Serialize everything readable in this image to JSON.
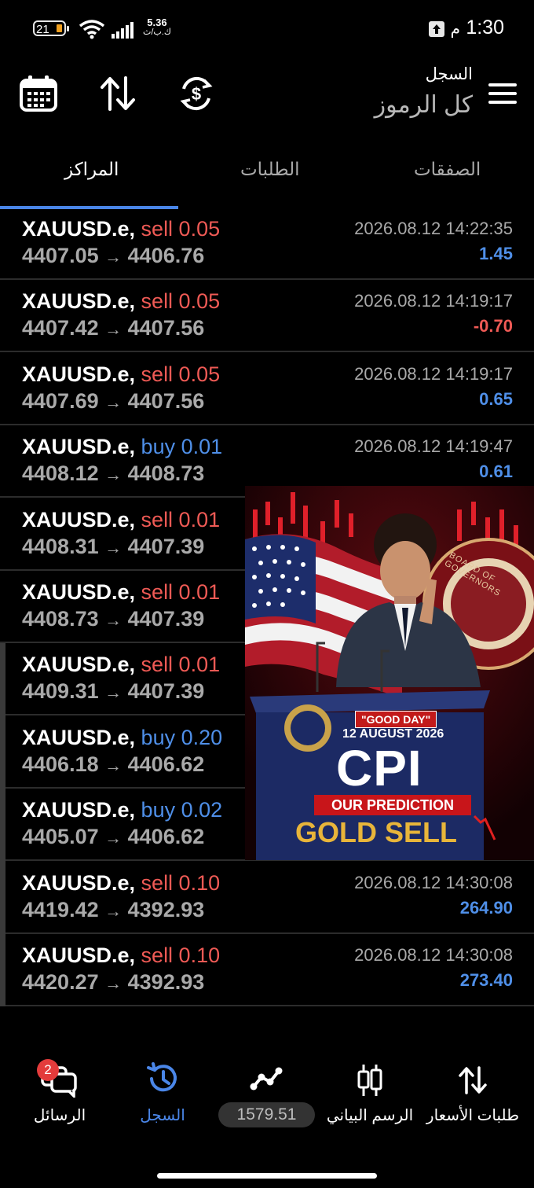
{
  "status": {
    "battery": "21",
    "speed_value": "5.36",
    "speed_unit": "ك.ب/ث",
    "time": "1:30",
    "ampm": "م"
  },
  "header": {
    "subtitle": "السجل",
    "title": "كل الرموز"
  },
  "tabs": [
    {
      "label": "الصفقات"
    },
    {
      "label": "الطلبات"
    },
    {
      "label": "المراكز"
    }
  ],
  "rows": [
    {
      "symbol": "XAUUSD.e,",
      "side": "sell 0.05",
      "type": "sell",
      "open": "4407.05",
      "close": "4406.76",
      "datetime": "2026.08.12 14:22:35",
      "profit": "1.45"
    },
    {
      "symbol": "XAUUSD.e,",
      "side": "sell 0.05",
      "type": "sell",
      "open": "4407.42",
      "close": "4407.56",
      "datetime": "2026.08.12 14:19:17",
      "profit": "-0.70"
    },
    {
      "symbol": "XAUUSD.e,",
      "side": "sell 0.05",
      "type": "sell",
      "open": "4407.69",
      "close": "4407.56",
      "datetime": "2026.08.12 14:19:17",
      "profit": "0.65"
    },
    {
      "symbol": "XAUUSD.e,",
      "side": "buy 0.01",
      "type": "buy",
      "open": "4408.12",
      "close": "4408.73",
      "datetime": "2026.08.12 14:19:47",
      "profit": "0.61"
    },
    {
      "symbol": "XAUUSD.e,",
      "side": "sell 0.01",
      "type": "sell",
      "open": "4408.31",
      "close": "4407.39",
      "datetime": "",
      "profit": ""
    },
    {
      "symbol": "XAUUSD.e,",
      "side": "sell 0.01",
      "type": "sell",
      "open": "4408.73",
      "close": "4407.39",
      "datetime": "",
      "profit": ""
    },
    {
      "symbol": "XAUUSD.e,",
      "side": "sell 0.01",
      "type": "sell",
      "open": "4409.31",
      "close": "4407.39",
      "datetime": "",
      "profit": ""
    },
    {
      "symbol": "XAUUSD.e,",
      "side": "buy 0.20",
      "type": "buy",
      "open": "4406.18",
      "close": "4406.62",
      "datetime": "",
      "profit": ""
    },
    {
      "symbol": "XAUUSD.e,",
      "side": "buy 0.02",
      "type": "buy",
      "open": "4405.07",
      "close": "4406.62",
      "datetime": "",
      "profit": ""
    },
    {
      "symbol": "XAUUSD.e,",
      "side": "sell 0.10",
      "type": "sell",
      "open": "4419.42",
      "close": "4392.93",
      "datetime": "2026.08.12 14:30:08",
      "profit": "264.90"
    },
    {
      "symbol": "XAUUSD.e,",
      "side": "sell 0.10",
      "type": "sell",
      "open": "4420.27",
      "close": "4392.93",
      "datetime": "2026.08.12 14:30:08",
      "profit": "273.40"
    }
  ],
  "arrow": "→",
  "ad": {
    "tag": "\"GOOD DAY\"",
    "date": "12 AUGUST 2026",
    "headline": "CPI",
    "prediction": "OUR PREDICTION",
    "call": "GOLD SELL",
    "seal_text": "BOARD OF GOVERNORS"
  },
  "nav": {
    "quotes": "طلبات الأسعار",
    "chart": "الرسم البياني",
    "trade_value": "1579.51",
    "history": "السجل",
    "messages": "الرسائل",
    "messages_badge": "2"
  },
  "colors": {
    "accent": "#4a86e8",
    "sell": "#ef5a55",
    "buy": "#4f8fe8"
  }
}
